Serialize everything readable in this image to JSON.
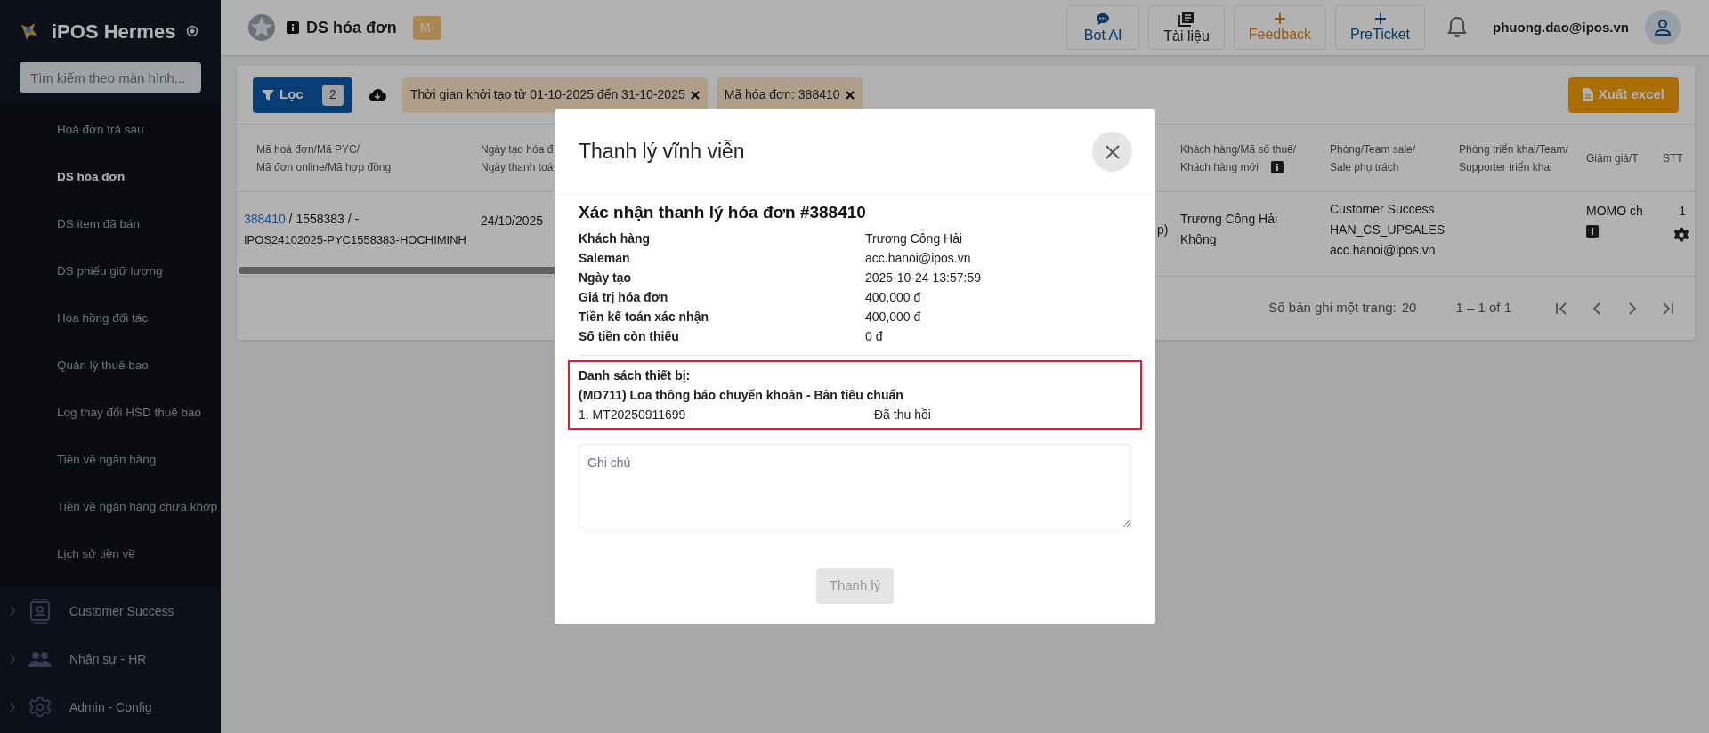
{
  "sidebar": {
    "app_name": "iPOS Hermes",
    "search": {
      "placeholder": "Tìm kiếm theo màn hình..."
    },
    "items": [
      {
        "label": "Hoá đơn trả sau",
        "selected": false
      },
      {
        "label": "DS hóa đơn",
        "selected": true
      },
      {
        "label": "DS item đã bán",
        "selected": false
      },
      {
        "label": "DS phiếu giữ lương",
        "selected": false
      },
      {
        "label": "Hoa hồng đối tác",
        "selected": false
      },
      {
        "label": "Quản lý thuê bao",
        "selected": false
      },
      {
        "label": "Log thay đổi HSD thuê bao",
        "selected": false
      },
      {
        "label": "Tiền về ngân hàng",
        "selected": false
      },
      {
        "label": "Tiền về ngân hàng chưa khớp",
        "selected": false
      },
      {
        "label": "Lịch sử tiền về",
        "selected": false
      }
    ],
    "groups": [
      {
        "label": "Customer Success",
        "expanded": false
      },
      {
        "label": "Nhân sự - HR",
        "expanded": false
      },
      {
        "label": "Admin - Config",
        "expanded": false
      }
    ]
  },
  "header": {
    "page_title": "DS hóa đơn",
    "badge": "M-",
    "actions": [
      {
        "label": "Bot AI",
        "kind": "primary"
      },
      {
        "label": "Tài liệu",
        "kind": "default"
      },
      {
        "label": "Feedback",
        "kind": "warning"
      },
      {
        "label": "PreTicket",
        "kind": "primary"
      }
    ],
    "user_email": "phuong.dao@ipos.vn"
  },
  "filters": {
    "filter_button": "Lọc",
    "filter_count": "2",
    "chips": [
      {
        "label": "Thời gian khởi tạo từ 01-10-2025 đến 31-10-2025"
      },
      {
        "label": "Mã hóa đơn: 388410"
      }
    ],
    "export_button": "Xuất excel"
  },
  "table": {
    "left_columns": [
      [
        "Mã hoá đơn/Mã PYC/",
        "Mã đơn online/Mã hợp đồng"
      ],
      [
        "Ngày tạo hóa đ",
        "Ngày thanh toá"
      ]
    ],
    "right_columns": [
      [
        "Khách hàng/Mã số thuế/",
        "Khách hàng mới"
      ],
      [
        "Phòng/Team sale/",
        "Sale phụ trách"
      ],
      [
        "Phòng triển khai/Team/",
        "Supporter triển khai"
      ],
      [
        "Giảm giá/T"
      ],
      [
        "STT"
      ]
    ],
    "row": {
      "invoice_link": "388410",
      "invoice_rest": " / 1558383 / -",
      "contract": "IPOS24102025-PYC1558383-HOCHIMINH",
      "date": "24/10/2025",
      "cut_cell": "p)",
      "customer": [
        "Trương Công Hải",
        "Không"
      ],
      "sales": [
        "Customer Success",
        "HAN_CS_UPSALES",
        "acc.hanoi@ipos.vn"
      ],
      "discount": "MOMO ch",
      "index": "1"
    },
    "pagination": {
      "page_size_label": "Số bản ghi một trang:",
      "page_size": "20",
      "range": "1 – 1 of 1"
    }
  },
  "modal": {
    "title": "Thanh lý vĩnh viễn",
    "heading": "Xác nhận thanh lý hóa đơn #388410",
    "details": [
      {
        "label": "Khách hàng",
        "value": "Trương Công Hải"
      },
      {
        "label": "Saleman",
        "value": "acc.hanoi@ipos.vn"
      },
      {
        "label": "Ngày tạo",
        "value": "2025-10-24 13:57:59"
      },
      {
        "label": "Giá trị hóa đơn",
        "value": "400,000 đ"
      },
      {
        "label": "Tiền kế toán xác nhận",
        "value": "400,000 đ"
      },
      {
        "label": "Số tiền còn thiếu",
        "value": "0 đ"
      }
    ],
    "devices": {
      "title": "Danh sách thiết bị:",
      "product": "(MD711) Loa thông báo chuyển khoản - Bản tiêu chuẩn",
      "items": [
        {
          "code": "1. MT20250911699",
          "status": "Đã thu hồi"
        }
      ]
    },
    "note": {
      "placeholder": "Ghi chú"
    },
    "submit": {
      "label": "Thanh lý",
      "disabled": true
    }
  }
}
